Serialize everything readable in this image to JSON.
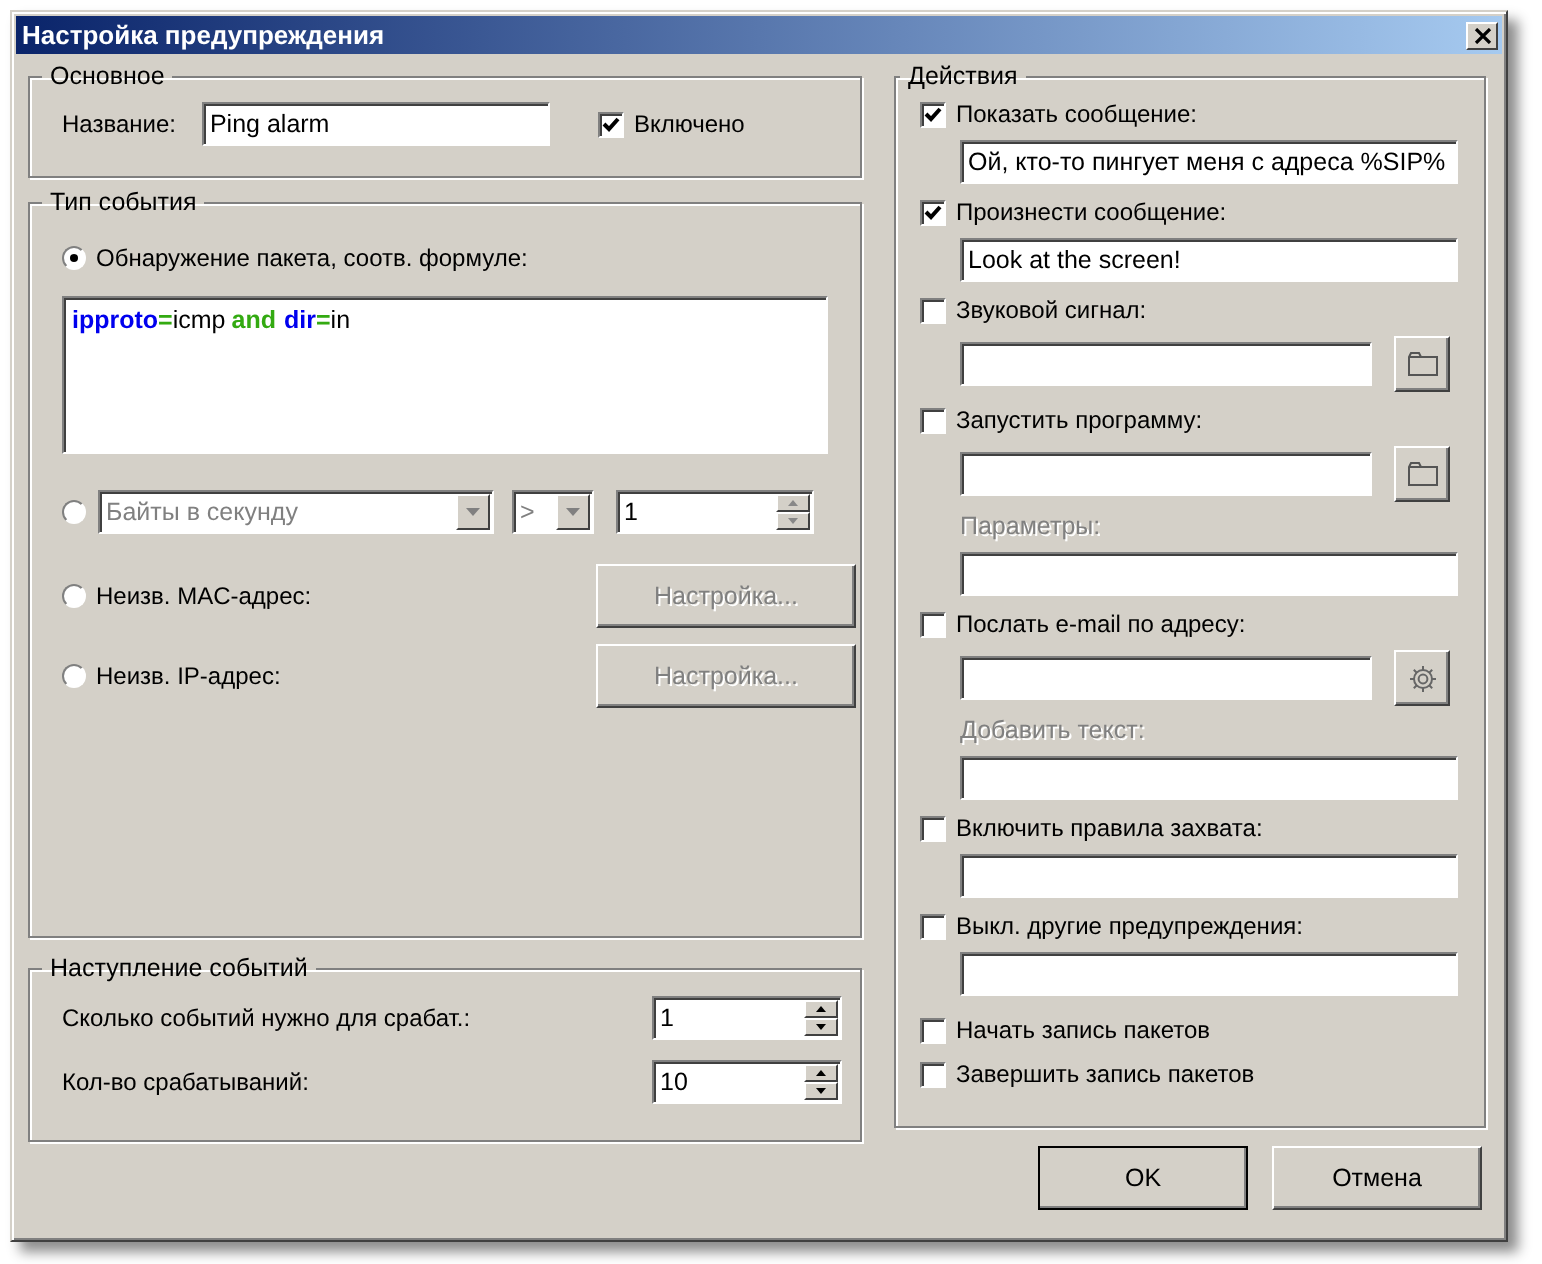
{
  "window": {
    "title": "Настройка предупреждения"
  },
  "general": {
    "title": "Основное",
    "name_label": "Название:",
    "name_value": "Ping alarm",
    "enabled": {
      "label": "Включено",
      "checked": true
    }
  },
  "event_type": {
    "title": "Тип события",
    "options": [
      {
        "kind": "formula",
        "label": "Обнаружение пакета, соотв. формуле:",
        "selected": true,
        "formula": [
          {
            "text": "ipproto",
            "kind": "field"
          },
          {
            "text": "=",
            "kind": "operator"
          },
          {
            "text": "icmp",
            "kind": "value"
          },
          {
            "text": "and",
            "kind": "logic"
          },
          {
            "text": "dir",
            "kind": "field"
          },
          {
            "text": "=",
            "kind": "operator"
          },
          {
            "text": "in",
            "kind": "value"
          }
        ]
      },
      {
        "kind": "rate",
        "selected": false,
        "metric": {
          "value": "Байты в секунду",
          "disabled": true
        },
        "operator": {
          "value": ">",
          "disabled": true
        },
        "threshold": "1"
      },
      {
        "kind": "button",
        "label": "Неизв. MAC-адрес:",
        "selected": false,
        "button": {
          "label": "Настройка...",
          "disabled": true
        }
      },
      {
        "kind": "button",
        "label": "Неизв. IP-адрес:",
        "selected": false,
        "button": {
          "label": "Настройка...",
          "disabled": true
        }
      }
    ]
  },
  "occurrence": {
    "title": "Наступление событий",
    "rows": [
      {
        "label": "Сколько событий нужно для срабат.:",
        "value": "1"
      },
      {
        "label": "Кол-во срабатываний:",
        "value": "10"
      }
    ]
  },
  "actions": {
    "title": "Действия",
    "items": [
      {
        "kind": "text",
        "label": "Показать сообщение:",
        "checked": true,
        "value": "Ой, кто-то пингует меня с адреса %SIP%"
      },
      {
        "kind": "text",
        "label": "Произнести сообщение:",
        "checked": true,
        "value": "Look at the screen!"
      },
      {
        "kind": "browse",
        "label": "Звуковой сигнал:",
        "checked": false
      },
      {
        "kind": "browse",
        "label": "Запустить программу:",
        "checked": false,
        "sub_label": {
          "text": "Параметры:",
          "disabled": true
        }
      },
      {
        "kind": "settings",
        "label": "Послать e-mail по адресу:",
        "checked": false,
        "sub_label": {
          "text": "Добавить текст:",
          "disabled": true
        }
      },
      {
        "kind": "text",
        "label": "Включить правила захвата:",
        "checked": false
      },
      {
        "kind": "text",
        "label": "Выкл. другие предупреждения:",
        "checked": false
      },
      {
        "kind": "plain",
        "label": "Начать запись пакетов",
        "checked": false
      },
      {
        "kind": "plain",
        "label": "Завершить запись пакетов",
        "checked": false
      }
    ]
  },
  "buttons": [
    {
      "label": "OK",
      "default": true
    },
    {
      "label": "Отмена",
      "default": false
    }
  ]
}
